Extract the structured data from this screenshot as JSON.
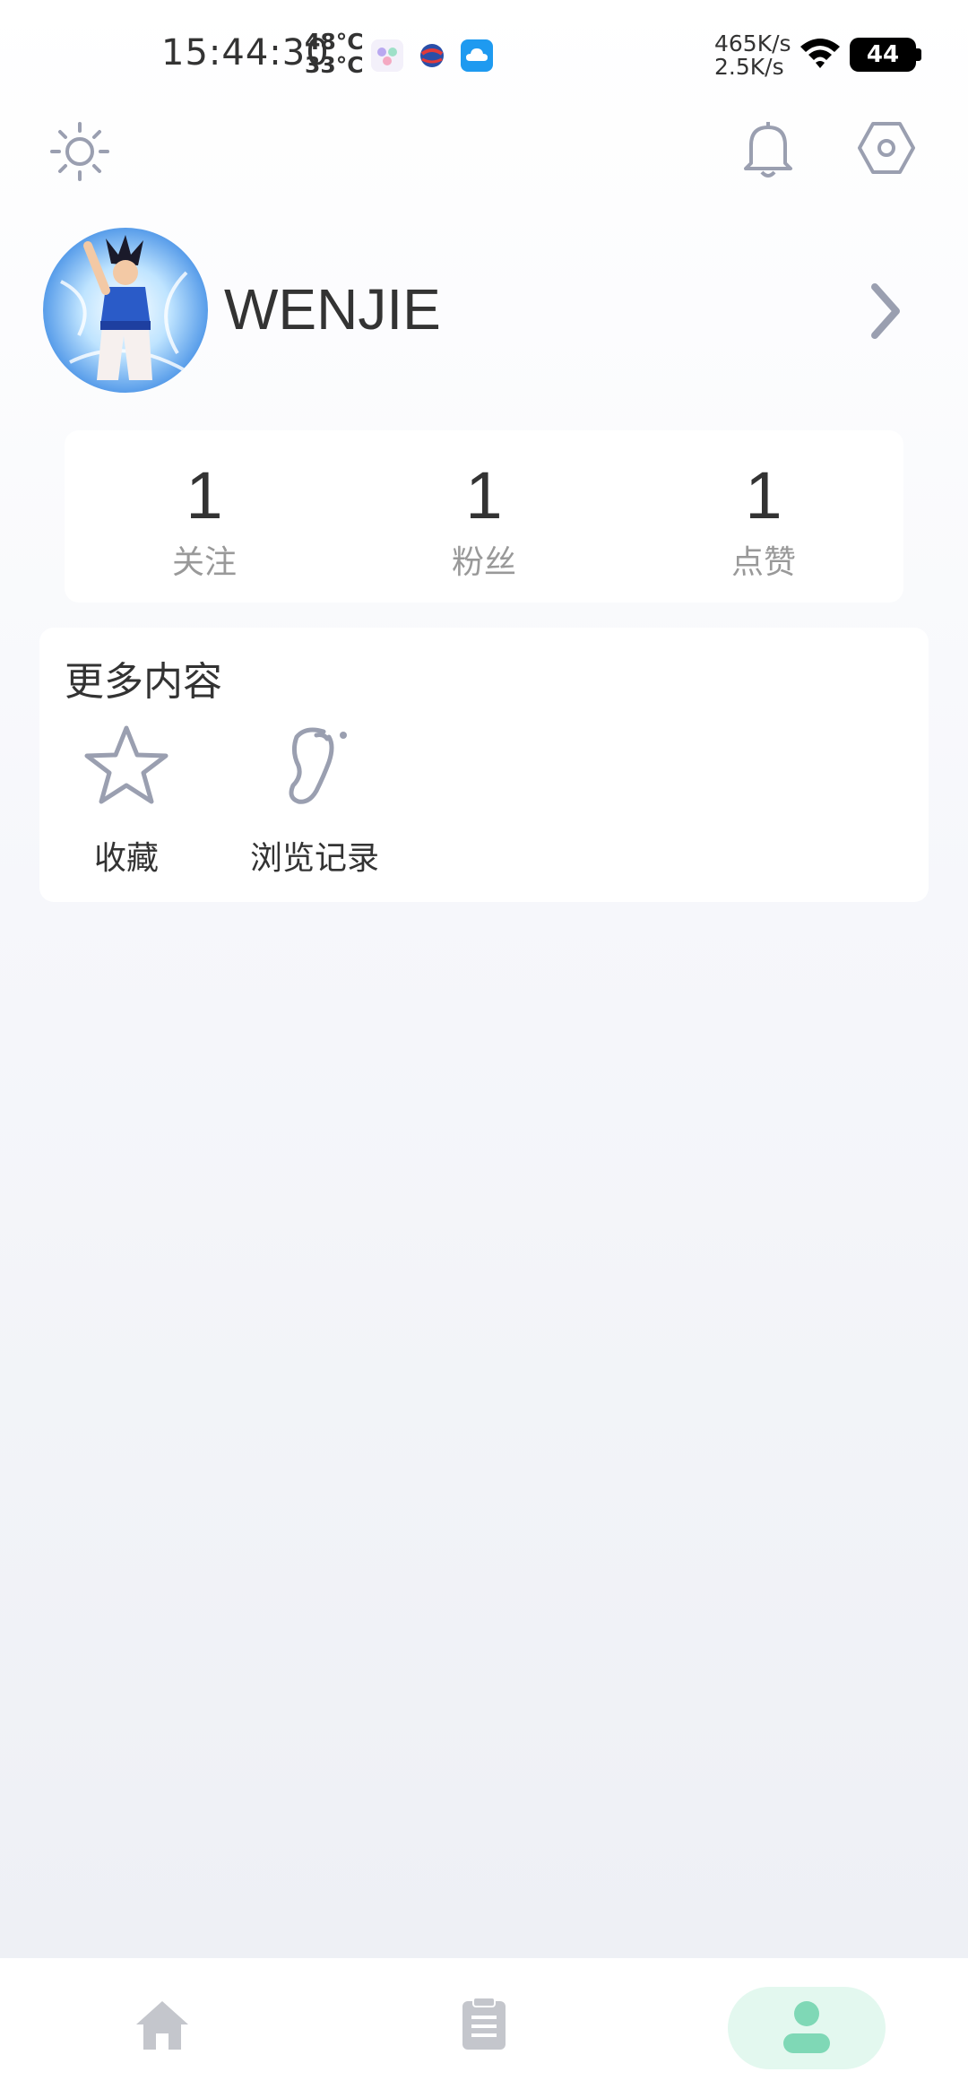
{
  "status_bar": {
    "time": "15:44:30",
    "temp_high": "48°C",
    "temp_low": "33°C",
    "net_up": "465K/s",
    "net_down": "2.5K/s",
    "battery": "44"
  },
  "header": {
    "icons": [
      "sun-icon",
      "bell-icon",
      "settings-icon"
    ]
  },
  "profile": {
    "username": "WENJIE"
  },
  "stats": [
    {
      "value": "1",
      "label": "关注"
    },
    {
      "value": "1",
      "label": "粉丝"
    },
    {
      "value": "1",
      "label": "点赞"
    }
  ],
  "more": {
    "title": "更多内容",
    "items": [
      {
        "label": "收藏",
        "icon": "star-icon"
      },
      {
        "label": "浏览记录",
        "icon": "footprint-icon"
      }
    ]
  },
  "tabbar": {
    "tabs": [
      {
        "icon": "home-icon",
        "active": false
      },
      {
        "icon": "clipboard-icon",
        "active": false
      },
      {
        "icon": "user-icon",
        "active": true
      }
    ],
    "active_color": "#7fd8b6"
  }
}
